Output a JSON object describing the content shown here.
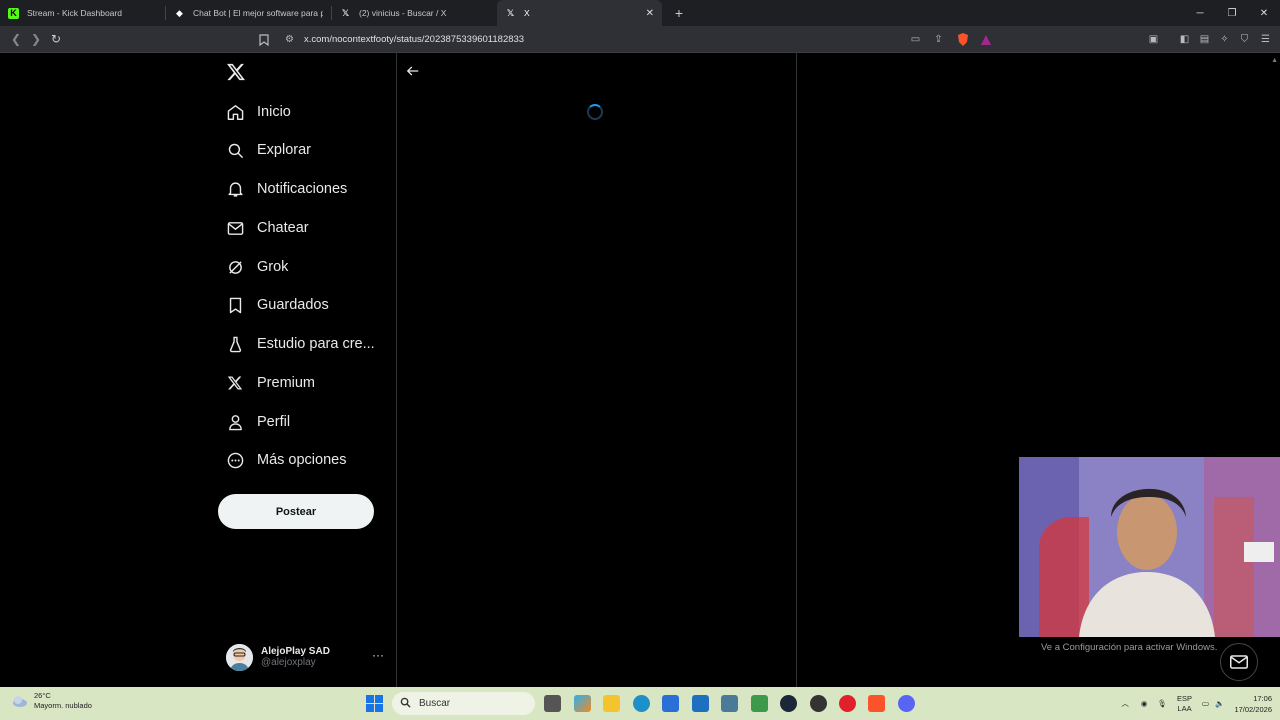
{
  "browser": {
    "tabs": [
      {
        "title": "Stream - Kick Dashboard",
        "active": false
      },
      {
        "title": "Chat Bot | El mejor software para pot",
        "active": false
      },
      {
        "title": "(2) vinicius - Buscar / X",
        "active": false
      },
      {
        "title": "X",
        "active": true
      }
    ],
    "new_tab": "+",
    "url": "x.com/nocontextfooty/status/2023875339601182833"
  },
  "sidebar": {
    "items": [
      {
        "label": "Inicio",
        "icon": "home-icon"
      },
      {
        "label": "Explorar",
        "icon": "search-icon"
      },
      {
        "label": "Notificaciones",
        "icon": "bell-icon"
      },
      {
        "label": "Chatear",
        "icon": "mail-icon"
      },
      {
        "label": "Grok",
        "icon": "grok-icon"
      },
      {
        "label": "Guardados",
        "icon": "bookmark-icon"
      },
      {
        "label": "Estudio para cre...",
        "icon": "flask-icon"
      },
      {
        "label": "Premium",
        "icon": "x-icon"
      },
      {
        "label": "Perfil",
        "icon": "person-icon"
      },
      {
        "label": "Más opciones",
        "icon": "more-circle-icon"
      }
    ],
    "post_label": "Postear",
    "account": {
      "name": "AlejoPlay SAD",
      "handle": "@alejoxplay",
      "more": "···"
    }
  },
  "overlay": {
    "activate_windows": "Ve a Configuración para activar Windows."
  },
  "taskbar": {
    "weather_temp": "26°C",
    "weather_desc": "Mayorm. nublado",
    "search_placeholder": "Buscar",
    "lang_top": "ESP",
    "lang_bottom": "LAA",
    "time": "17:06",
    "date": "17/02/2026"
  },
  "colors": {
    "accent": "#1d9bf0",
    "background": "#000000",
    "text": "#e7e9ea",
    "muted": "#71767b"
  }
}
